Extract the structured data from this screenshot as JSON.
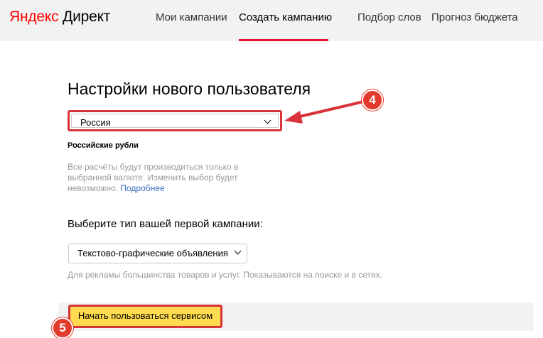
{
  "header": {
    "logo_yandex": "Яндекс",
    "logo_direct": "Директ",
    "nav": [
      {
        "label": "Мои кампании"
      },
      {
        "label": "Создать кампанию",
        "active": true
      },
      {
        "label": "Подбор слов"
      },
      {
        "label": "Прогноз бюджета"
      }
    ]
  },
  "main": {
    "title": "Настройки нового пользователя",
    "country_select": {
      "value": "Россия"
    },
    "currency": "Российские рубли",
    "note_text": "Все расчёты будут производиться только в выбранной валюте. Изменить выбор будет невозможно.",
    "note_link": "Подробнее",
    "campaign_prompt": "Выберите тип вашей первой кампании:",
    "campaign_select": {
      "value": "Текстово-графические объявления"
    },
    "campaign_hint": "Для рекламы большинства товаров и услуг. Показываются на поиске и в сетях.",
    "start_button": "Начать пользоваться сервисом"
  },
  "annotations": {
    "badge_country": "4",
    "badge_start": "5"
  },
  "colors": {
    "brand_red": "#ff0000",
    "active_underline": "#e8122e",
    "highlight_border": "#d9323a",
    "button_yellow": "#ffdb4d",
    "badge_red": "#e23b2e",
    "link_blue": "#3a6ec2"
  }
}
